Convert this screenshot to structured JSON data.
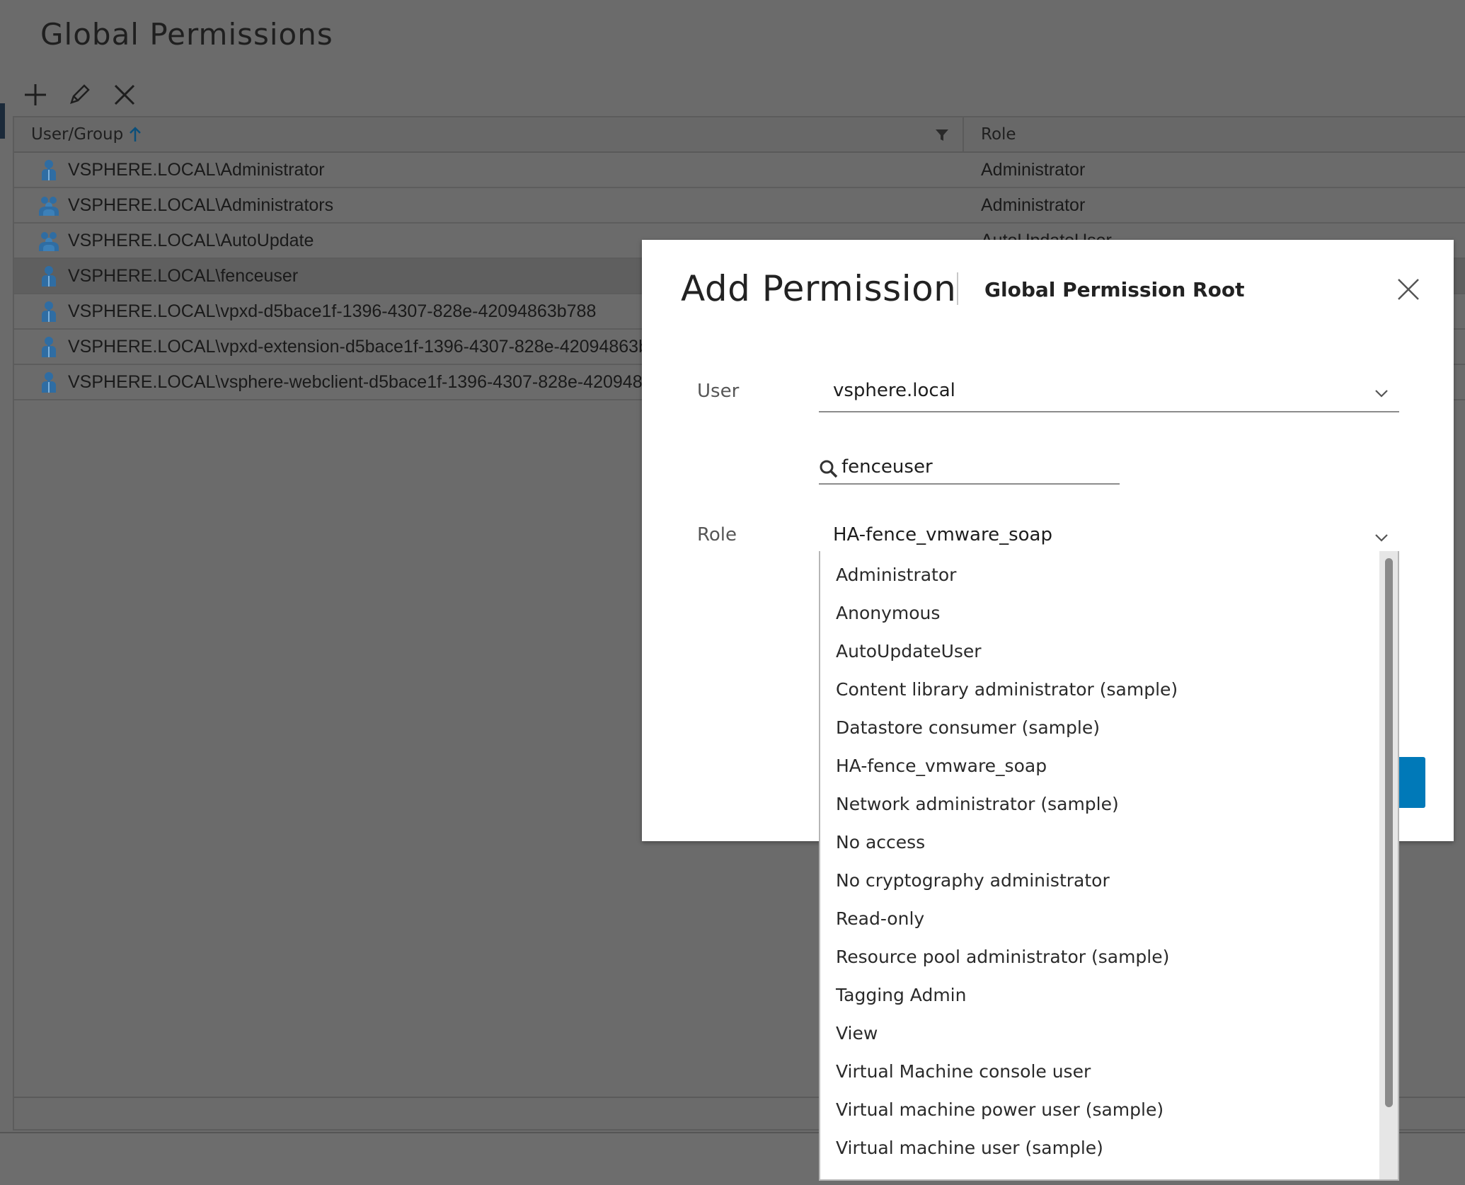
{
  "page": {
    "title": "Global Permissions"
  },
  "toolbar": {
    "add_icon": "plus-icon",
    "edit_icon": "pencil-icon",
    "delete_icon": "x-icon"
  },
  "grid": {
    "columns": {
      "user_group": "User/Group",
      "role": "Role"
    },
    "rows": [
      {
        "user": "VSPHERE.LOCAL\\Administrator",
        "role": "Administrator",
        "icon": "user-icon"
      },
      {
        "user": "VSPHERE.LOCAL\\Administrators",
        "role": "Administrator",
        "icon": "group-icon"
      },
      {
        "user": "VSPHERE.LOCAL\\AutoUpdate",
        "role": "AutoUpdateUser",
        "icon": "group-icon"
      },
      {
        "user": "VSPHERE.LOCAL\\fenceuser",
        "role": "",
        "icon": "user-icon",
        "selected": true
      },
      {
        "user": "VSPHERE.LOCAL\\vpxd-d5bace1f-1396-4307-828e-42094863b788",
        "role": "",
        "icon": "user-icon"
      },
      {
        "user": "VSPHERE.LOCAL\\vpxd-extension-d5bace1f-1396-4307-828e-42094863b",
        "role": "",
        "icon": "user-icon"
      },
      {
        "user": "VSPHERE.LOCAL\\vsphere-webclient-d5bace1f-1396-4307-828e-420948",
        "role": "",
        "icon": "user-icon"
      }
    ]
  },
  "modal": {
    "title": "Add Permission",
    "subtitle": "Global Permission Root",
    "user_label": "User",
    "user_domain": "vsphere.local",
    "search_value": "fenceuser",
    "role_label": "Role",
    "role_value": "HA-fence_vmware_soap"
  },
  "role_options": [
    "Administrator",
    "Anonymous",
    "AutoUpdateUser",
    "Content library administrator (sample)",
    "Datastore consumer (sample)",
    "HA-fence_vmware_soap",
    "Network administrator (sample)",
    "No access",
    "No cryptography administrator",
    "Read-only",
    "Resource pool administrator (sample)",
    "Tagging Admin",
    "View",
    "Virtual Machine console user",
    "Virtual machine power user (sample)",
    "Virtual machine user (sample)"
  ],
  "colors": {
    "accent": "#0079b8",
    "overlay": "#6b6b6b"
  }
}
